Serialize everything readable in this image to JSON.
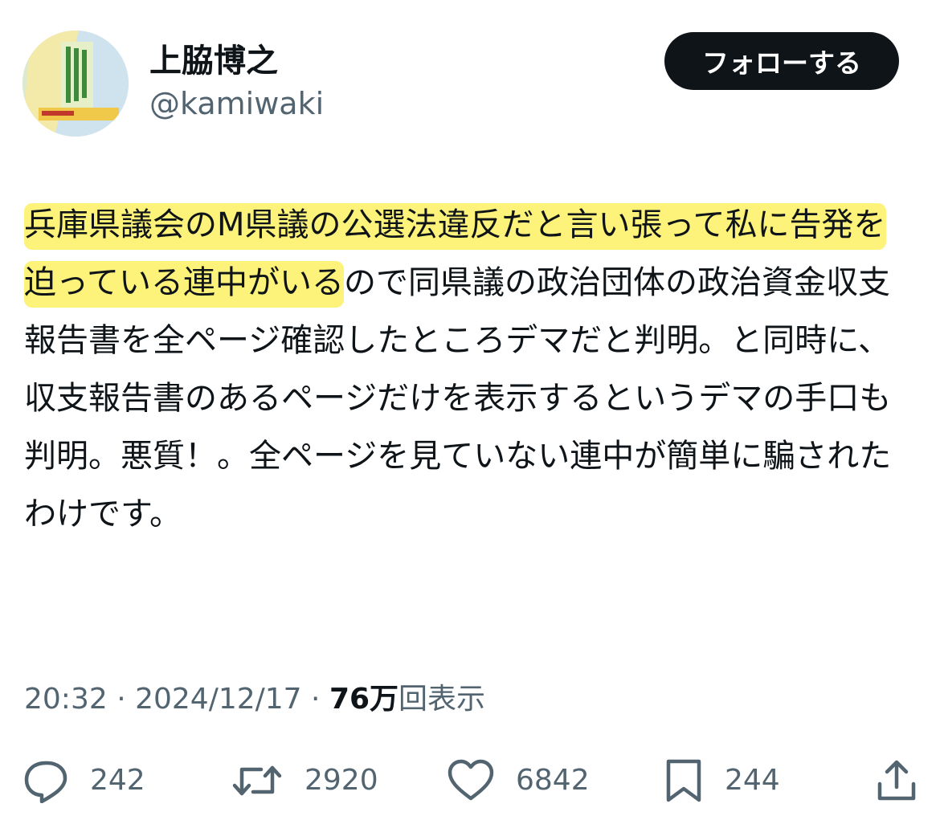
{
  "user": {
    "display_name": "上脇博之",
    "handle": "@kamiwaki",
    "avatar_icon": "profile-photo"
  },
  "follow_button": {
    "label": "フォローする"
  },
  "tweet": {
    "highlighted_text": "兵庫県議会のM県議の公選法違反だと言い張って私に告発を迫っている連中がいる",
    "body_text": "ので同県議の政治団体の政治資金収支報告書を全ページ確認したところデマだと判明。と同時に、収支報告書のあるページだけを表示するというデマの手口も判明。悪質！。全ページを見ていない連中が簡単に騙されたわけです。",
    "highlight_color": "#fdf27a"
  },
  "meta": {
    "time": "20:32",
    "separator": " · ",
    "date": "2024/12/17",
    "views_count": "76万",
    "views_label": "回表示"
  },
  "actions": {
    "reply": {
      "icon": "reply-bubble-icon",
      "count": "242"
    },
    "retweet": {
      "icon": "retweet-icon",
      "count": "2920"
    },
    "like": {
      "icon": "heart-icon",
      "count": "6842"
    },
    "bookmark": {
      "icon": "bookmark-icon",
      "count": "244"
    },
    "share": {
      "icon": "share-icon"
    }
  },
  "colors": {
    "text_primary": "#0f1419",
    "text_secondary": "#536471",
    "button_background": "#0f1419"
  }
}
